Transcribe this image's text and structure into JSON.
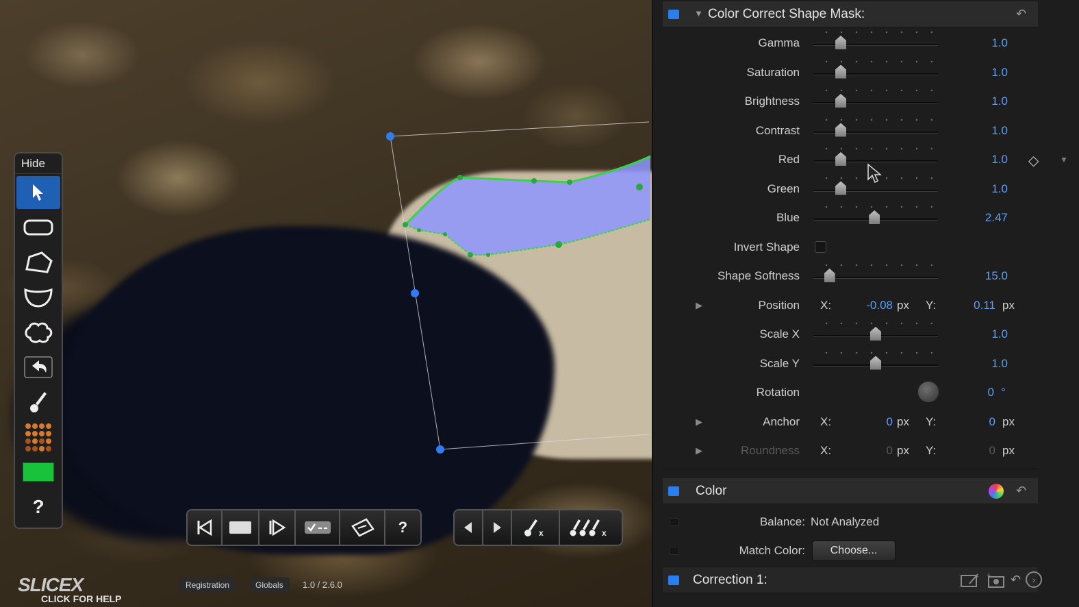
{
  "viewer": {
    "tool_palette": {
      "hide_label": "Hide",
      "tools": [
        "select-arrow",
        "rectangle-shape",
        "polygon-shape",
        "bezier-shape",
        "freeform-shape",
        "undo",
        "paint-brush",
        "dot-grid",
        "color-swatch",
        "help"
      ],
      "help_label": "?",
      "swatch_color": "#18c23a"
    },
    "transport_left": [
      "◀|",
      "■",
      "|▶",
      "✓--",
      "▱",
      "?"
    ],
    "transport_right": [
      "◀",
      "▶",
      "brush-x",
      "brushes-x"
    ],
    "brand": "SLICEX",
    "brand_sub": "CLICK FOR HELP",
    "footer": {
      "registration": "Registration",
      "globals": "Globals",
      "version": "1.0 / 2.6.0"
    }
  },
  "inspector": {
    "shape_mask": {
      "title": "Color Correct Shape Mask:",
      "params": [
        {
          "label": "Gamma",
          "value": "1.0",
          "pos": 0.22
        },
        {
          "label": "Saturation",
          "value": "1.0",
          "pos": 0.22
        },
        {
          "label": "Brightness",
          "value": "1.0",
          "pos": 0.22
        },
        {
          "label": "Contrast",
          "value": "1.0",
          "pos": 0.22
        },
        {
          "label": "Red",
          "value": "1.0",
          "pos": 0.22
        },
        {
          "label": "Green",
          "value": "1.0",
          "pos": 0.22
        },
        {
          "label": "Blue",
          "value": "2.47",
          "pos": 0.49
        }
      ],
      "invert_shape": {
        "label": "Invert Shape",
        "checked": false
      },
      "shape_softness": {
        "label": "Shape Softness",
        "value": "15.0",
        "pos": 0.13
      },
      "position": {
        "label": "Position",
        "x_label": "X:",
        "x_value": "-0.08",
        "x_unit": "px",
        "y_label": "Y:",
        "y_value": "0.11",
        "y_unit": "px"
      },
      "scale_x": {
        "label": "Scale X",
        "value": "1.0",
        "pos": 0.5
      },
      "scale_y": {
        "label": "Scale Y",
        "value": "1.0",
        "pos": 0.5
      },
      "rotation": {
        "label": "Rotation",
        "value": "0",
        "unit": "°"
      },
      "anchor": {
        "label": "Anchor",
        "x_label": "X:",
        "x_value": "0",
        "x_unit": "px",
        "y_label": "Y:",
        "y_value": "0",
        "y_unit": "px"
      },
      "roundness": {
        "label": "Roundness",
        "x_label": "X:",
        "x_value": "0",
        "x_unit": "px",
        "y_label": "Y:",
        "y_value": "0",
        "y_unit": "px"
      }
    },
    "color": {
      "title": "Color",
      "balance_label": "Balance:",
      "balance_value": "Not Analyzed",
      "match_label": "Match Color:",
      "choose_button": "Choose..."
    },
    "correction": {
      "title": "Correction 1:"
    }
  },
  "colors": {
    "accent_blue": "#2a7ff0",
    "value_blue": "#5fa0ef",
    "mask_green": "#3bd14a",
    "mask_fill": "#8f96ff"
  }
}
